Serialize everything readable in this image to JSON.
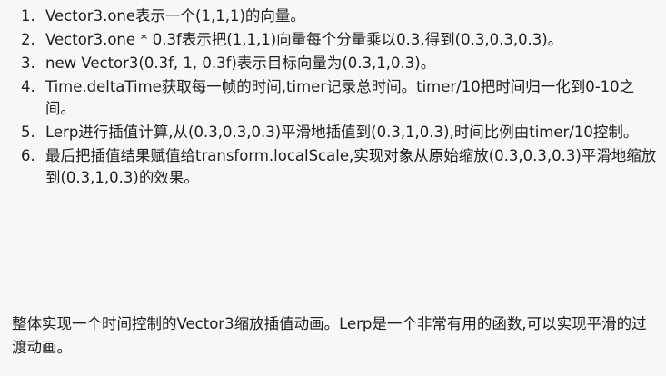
{
  "steps": [
    {
      "num": "1.",
      "text": "Vector3.one表示一个(1,1,1)的向量。"
    },
    {
      "num": "2.",
      "text": "Vector3.one * 0.3f表示把(1,1,1)向量每个分量乘以0.3,得到(0.3,0.3,0.3)。"
    },
    {
      "num": "3.",
      "text": "new Vector3(0.3f, 1, 0.3f)表示目标向量为(0.3,1,0.3)。"
    },
    {
      "num": "4.",
      "text": "Time.deltaTime获取每一帧的时间,timer记录总时间。timer/10把时间归一化到0-10之间。"
    },
    {
      "num": "5.",
      "text": "Lerp进行插值计算,从(0.3,0.3,0.3)平滑地插值到(0.3,1,0.3),时间比例由timer/10控制。"
    },
    {
      "num": "6.",
      "text": "最后把插值结果赋值给transform.localScale,实现对象从原始缩放(0.3,0.3,0.3)平滑地缩放到(0.3,1,0.3)的效果。"
    }
  ],
  "summary": "整体实现一个时间控制的Vector3缩放插值动画。Lerp是一个非常有用的函数,可以实现平滑的过渡动画。"
}
